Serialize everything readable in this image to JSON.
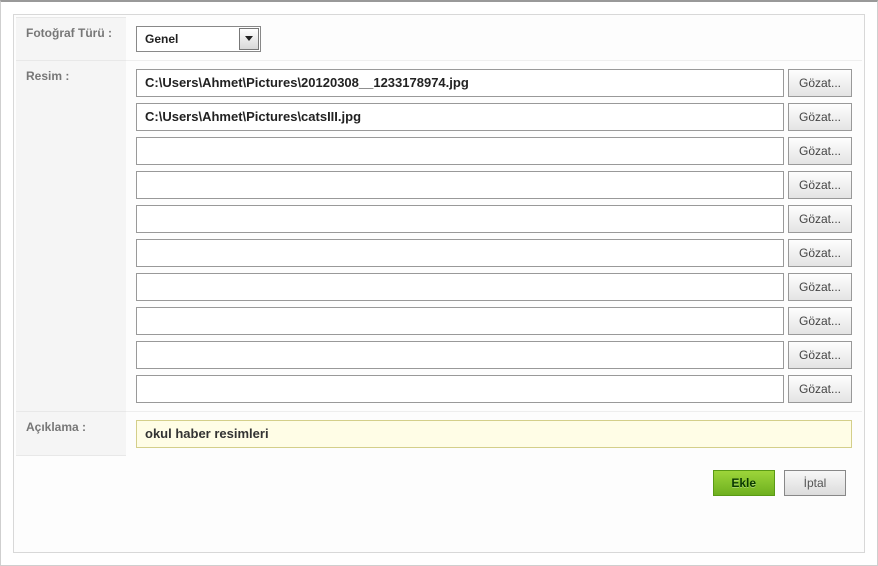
{
  "labels": {
    "photo_type": "Fotoğraf Türü :",
    "image": "Resim :",
    "description": "Açıklama :"
  },
  "photo_type": {
    "selected": "Genel"
  },
  "files": {
    "browse_label": "Gözat...",
    "rows": [
      {
        "value": "C:\\Users\\Ahmet\\Pictures\\20120308__1233178974.jpg"
      },
      {
        "value": "C:\\Users\\Ahmet\\Pictures\\catsIII.jpg"
      },
      {
        "value": ""
      },
      {
        "value": ""
      },
      {
        "value": ""
      },
      {
        "value": ""
      },
      {
        "value": ""
      },
      {
        "value": ""
      },
      {
        "value": ""
      },
      {
        "value": ""
      }
    ]
  },
  "description": {
    "value": "okul haber resimleri"
  },
  "buttons": {
    "add": "Ekle",
    "cancel": "İptal"
  }
}
